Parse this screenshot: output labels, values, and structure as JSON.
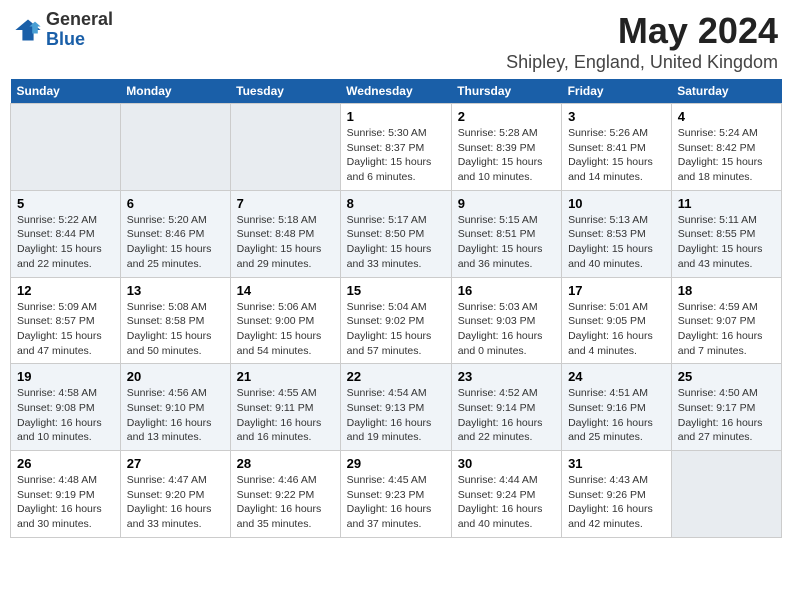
{
  "header": {
    "logo_line1": "General",
    "logo_line2": "Blue",
    "title": "May 2024",
    "subtitle": "Shipley, England, United Kingdom"
  },
  "columns": [
    "Sunday",
    "Monday",
    "Tuesday",
    "Wednesday",
    "Thursday",
    "Friday",
    "Saturday"
  ],
  "weeks": [
    [
      {
        "day": "",
        "info": ""
      },
      {
        "day": "",
        "info": ""
      },
      {
        "day": "",
        "info": ""
      },
      {
        "day": "1",
        "info": "Sunrise: 5:30 AM\nSunset: 8:37 PM\nDaylight: 15 hours\nand 6 minutes."
      },
      {
        "day": "2",
        "info": "Sunrise: 5:28 AM\nSunset: 8:39 PM\nDaylight: 15 hours\nand 10 minutes."
      },
      {
        "day": "3",
        "info": "Sunrise: 5:26 AM\nSunset: 8:41 PM\nDaylight: 15 hours\nand 14 minutes."
      },
      {
        "day": "4",
        "info": "Sunrise: 5:24 AM\nSunset: 8:42 PM\nDaylight: 15 hours\nand 18 minutes."
      }
    ],
    [
      {
        "day": "5",
        "info": "Sunrise: 5:22 AM\nSunset: 8:44 PM\nDaylight: 15 hours\nand 22 minutes."
      },
      {
        "day": "6",
        "info": "Sunrise: 5:20 AM\nSunset: 8:46 PM\nDaylight: 15 hours\nand 25 minutes."
      },
      {
        "day": "7",
        "info": "Sunrise: 5:18 AM\nSunset: 8:48 PM\nDaylight: 15 hours\nand 29 minutes."
      },
      {
        "day": "8",
        "info": "Sunrise: 5:17 AM\nSunset: 8:50 PM\nDaylight: 15 hours\nand 33 minutes."
      },
      {
        "day": "9",
        "info": "Sunrise: 5:15 AM\nSunset: 8:51 PM\nDaylight: 15 hours\nand 36 minutes."
      },
      {
        "day": "10",
        "info": "Sunrise: 5:13 AM\nSunset: 8:53 PM\nDaylight: 15 hours\nand 40 minutes."
      },
      {
        "day": "11",
        "info": "Sunrise: 5:11 AM\nSunset: 8:55 PM\nDaylight: 15 hours\nand 43 minutes."
      }
    ],
    [
      {
        "day": "12",
        "info": "Sunrise: 5:09 AM\nSunset: 8:57 PM\nDaylight: 15 hours\nand 47 minutes."
      },
      {
        "day": "13",
        "info": "Sunrise: 5:08 AM\nSunset: 8:58 PM\nDaylight: 15 hours\nand 50 minutes."
      },
      {
        "day": "14",
        "info": "Sunrise: 5:06 AM\nSunset: 9:00 PM\nDaylight: 15 hours\nand 54 minutes."
      },
      {
        "day": "15",
        "info": "Sunrise: 5:04 AM\nSunset: 9:02 PM\nDaylight: 15 hours\nand 57 minutes."
      },
      {
        "day": "16",
        "info": "Sunrise: 5:03 AM\nSunset: 9:03 PM\nDaylight: 16 hours\nand 0 minutes."
      },
      {
        "day": "17",
        "info": "Sunrise: 5:01 AM\nSunset: 9:05 PM\nDaylight: 16 hours\nand 4 minutes."
      },
      {
        "day": "18",
        "info": "Sunrise: 4:59 AM\nSunset: 9:07 PM\nDaylight: 16 hours\nand 7 minutes."
      }
    ],
    [
      {
        "day": "19",
        "info": "Sunrise: 4:58 AM\nSunset: 9:08 PM\nDaylight: 16 hours\nand 10 minutes."
      },
      {
        "day": "20",
        "info": "Sunrise: 4:56 AM\nSunset: 9:10 PM\nDaylight: 16 hours\nand 13 minutes."
      },
      {
        "day": "21",
        "info": "Sunrise: 4:55 AM\nSunset: 9:11 PM\nDaylight: 16 hours\nand 16 minutes."
      },
      {
        "day": "22",
        "info": "Sunrise: 4:54 AM\nSunset: 9:13 PM\nDaylight: 16 hours\nand 19 minutes."
      },
      {
        "day": "23",
        "info": "Sunrise: 4:52 AM\nSunset: 9:14 PM\nDaylight: 16 hours\nand 22 minutes."
      },
      {
        "day": "24",
        "info": "Sunrise: 4:51 AM\nSunset: 9:16 PM\nDaylight: 16 hours\nand 25 minutes."
      },
      {
        "day": "25",
        "info": "Sunrise: 4:50 AM\nSunset: 9:17 PM\nDaylight: 16 hours\nand 27 minutes."
      }
    ],
    [
      {
        "day": "26",
        "info": "Sunrise: 4:48 AM\nSunset: 9:19 PM\nDaylight: 16 hours\nand 30 minutes."
      },
      {
        "day": "27",
        "info": "Sunrise: 4:47 AM\nSunset: 9:20 PM\nDaylight: 16 hours\nand 33 minutes."
      },
      {
        "day": "28",
        "info": "Sunrise: 4:46 AM\nSunset: 9:22 PM\nDaylight: 16 hours\nand 35 minutes."
      },
      {
        "day": "29",
        "info": "Sunrise: 4:45 AM\nSunset: 9:23 PM\nDaylight: 16 hours\nand 37 minutes."
      },
      {
        "day": "30",
        "info": "Sunrise: 4:44 AM\nSunset: 9:24 PM\nDaylight: 16 hours\nand 40 minutes."
      },
      {
        "day": "31",
        "info": "Sunrise: 4:43 AM\nSunset: 9:26 PM\nDaylight: 16 hours\nand 42 minutes."
      },
      {
        "day": "",
        "info": ""
      }
    ]
  ]
}
